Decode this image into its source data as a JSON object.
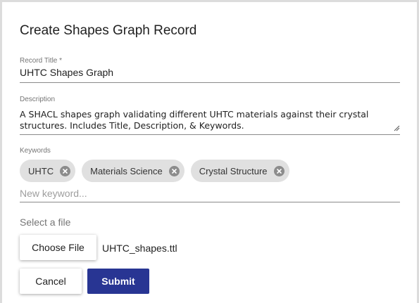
{
  "dialog": {
    "title": "Create Shapes Graph Record"
  },
  "record_title": {
    "label": "Record Title *",
    "value": "UHTC Shapes Graph"
  },
  "description": {
    "label": "Description",
    "value": "A SHACL shapes graph validating different UHTC materials against their crystal structures. Includes Title, Description, & Keywords."
  },
  "keywords": {
    "label": "Keywords",
    "chips": [
      {
        "label": "UHTC",
        "icon": "close-circle-icon"
      },
      {
        "label": "Materials Science",
        "icon": "close-circle-icon"
      },
      {
        "label": "Crystal Structure",
        "icon": "close-circle-icon"
      }
    ],
    "placeholder": "New keyword..."
  },
  "file": {
    "label": "Select a file",
    "button_label": "Choose File",
    "file_name": "UHTC_shapes.ttl"
  },
  "actions": {
    "cancel_label": "Cancel",
    "submit_label": "Submit"
  },
  "colors": {
    "primary": "#283593",
    "chip_background": "#e0e0e0",
    "chip_remove": "#8c8c8c"
  }
}
